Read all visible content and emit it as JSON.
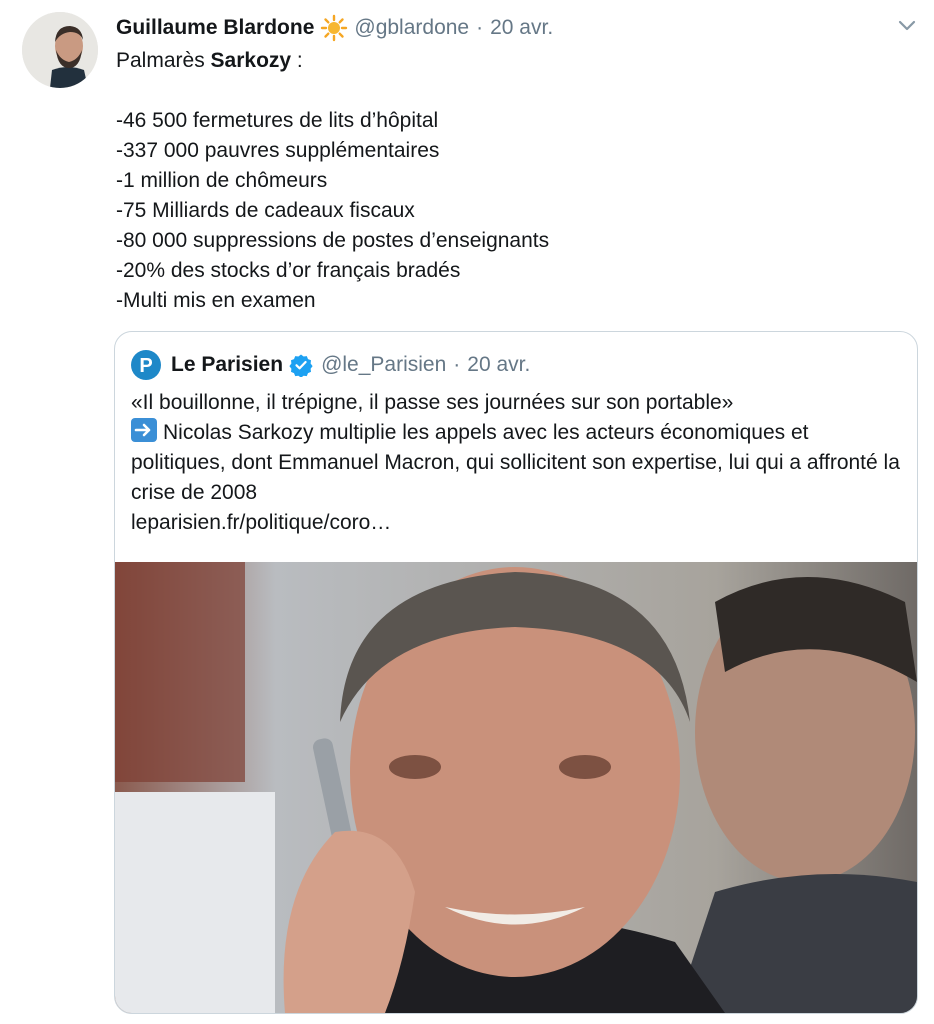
{
  "tweet": {
    "author_name": "Guillaume Blardone",
    "author_handle": "@gblardone",
    "separator": "·",
    "date": "20 avr.",
    "text_intro_prefix": "Palmarès ",
    "text_intro_bold": "Sarkozy",
    "text_intro_suffix": " :",
    "list": [
      "-46 500 fermetures de lits d’hôpital",
      "-337 000 pauvres supplémentaires",
      "-1 million de chômeurs",
      "-75 Milliards de cadeaux fiscaux",
      "-80 000 suppressions de postes d’enseignants",
      "-20% des stocks d’or français bradés",
      "-Multi mis en examen"
    ]
  },
  "quoted": {
    "name": "Le Parisien",
    "handle": "@le_Parisien",
    "separator": "·",
    "date": "20 avr.",
    "line1": "«Il bouillonne, il trépigne, il passe ses journées sur son portable»",
    "line2": "Nicolas Sarkozy multiplie les appels avec les acteurs économiques et politiques, dont Emmanuel Macron, qui sollicitent son expertise, lui qui a affronté la crise de 2008",
    "link": "leparisien.fr/politique/coro…",
    "logo_letter": "P"
  },
  "icons": {
    "sun": "sun-emoji-icon",
    "caret": "chevron-down-icon",
    "verified": "verified-badge-icon",
    "arrow": "right-arrow-emoji-icon"
  },
  "colors": {
    "text": "#14171a",
    "muted": "#657786",
    "border": "#ccd6dd",
    "verified": "#1da1f2",
    "parisien_blue": "#1e88c8"
  }
}
